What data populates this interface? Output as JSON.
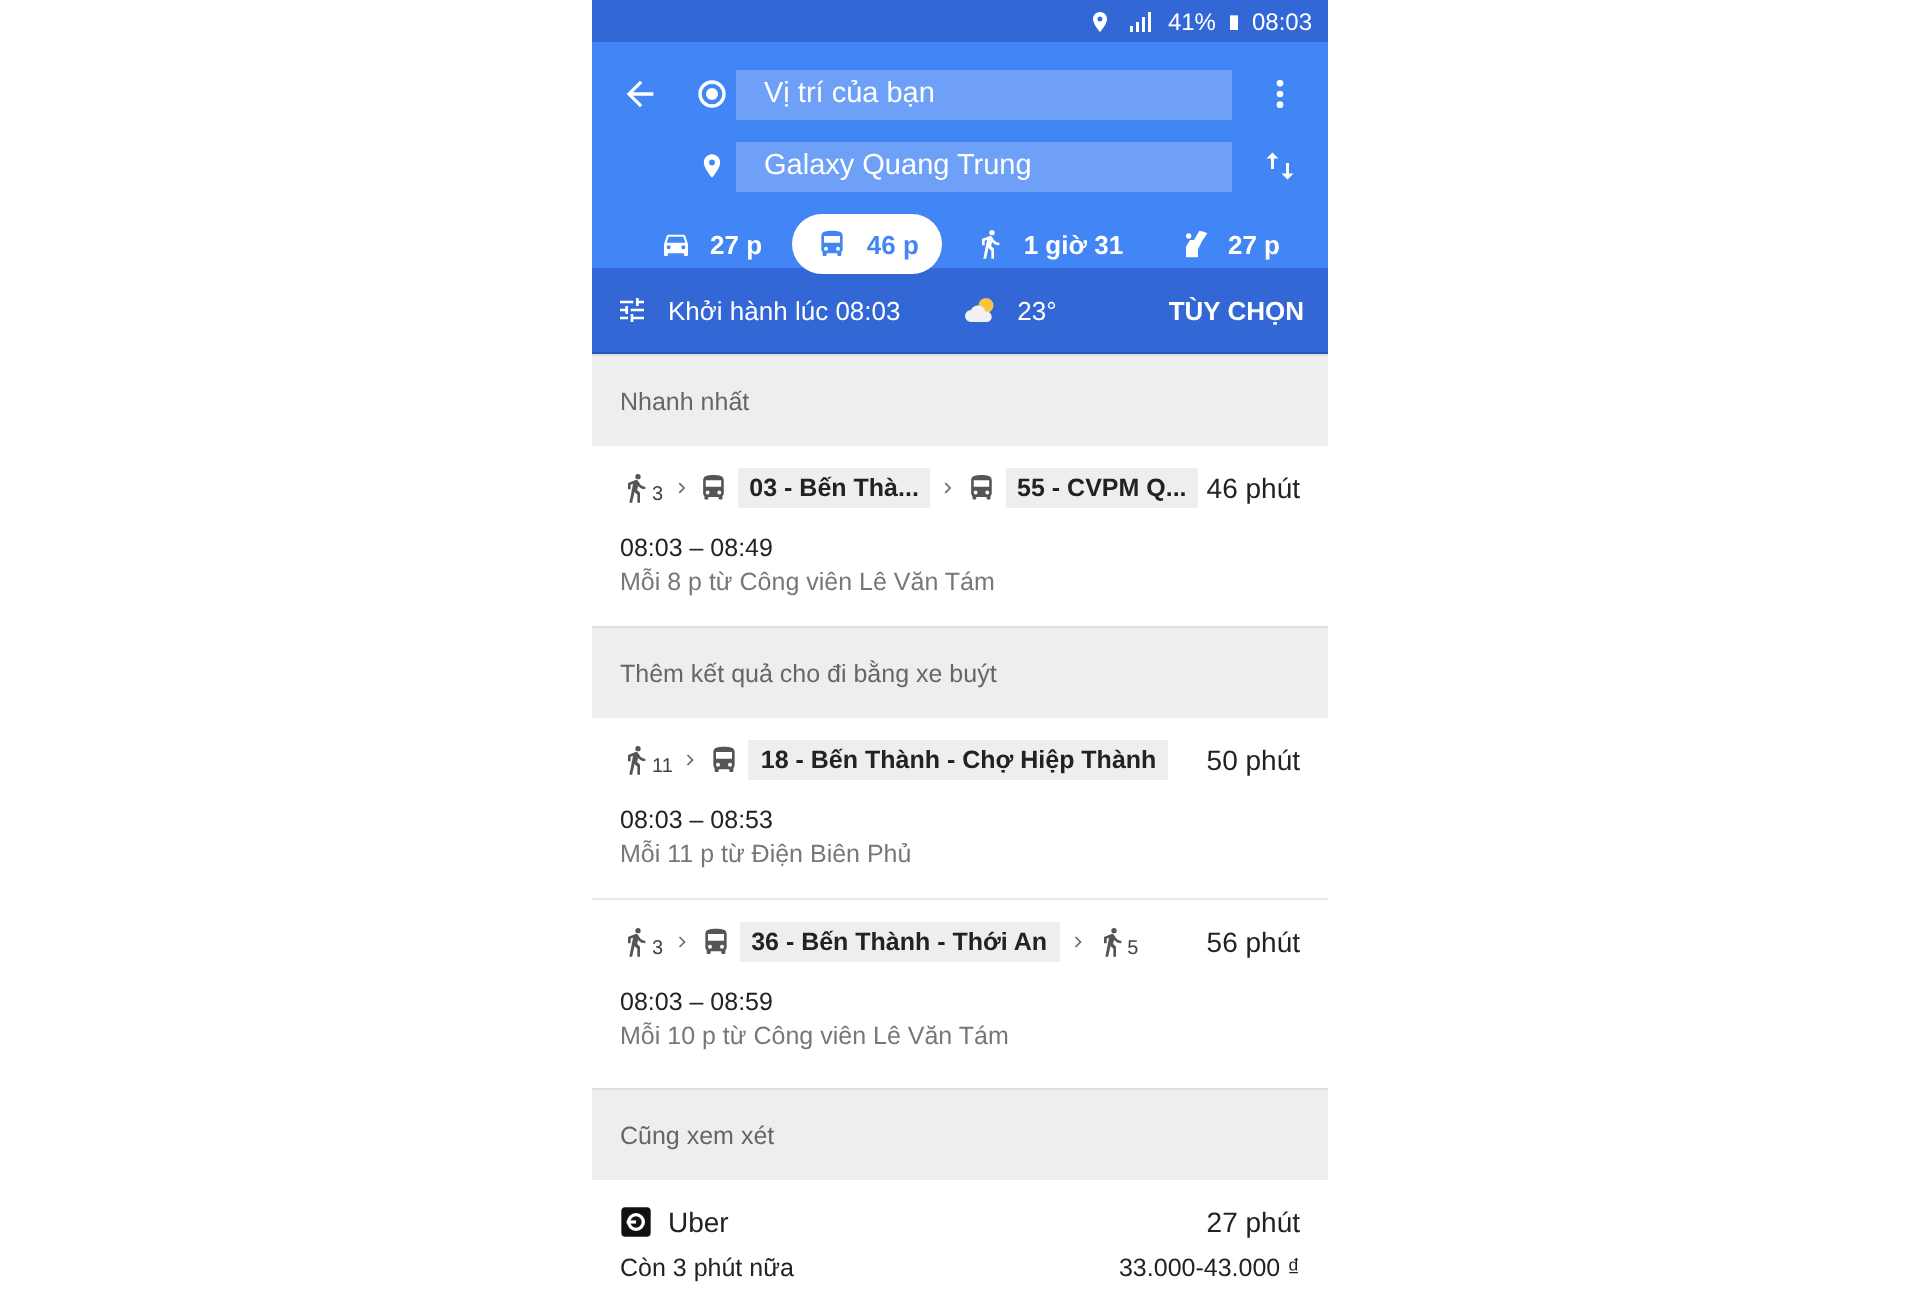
{
  "status_bar": {
    "battery": "41%",
    "time": "08:03"
  },
  "directions": {
    "origin": "Vị trí của bạn",
    "destination": "Galaxy Quang Trung"
  },
  "modes": [
    {
      "kind": "car",
      "label": "27 p",
      "selected": false
    },
    {
      "kind": "transit",
      "label": "46 p",
      "selected": true
    },
    {
      "kind": "walk",
      "label": "1 giờ 31",
      "selected": false
    },
    {
      "kind": "ride",
      "label": "27 p",
      "selected": false
    }
  ],
  "options_bar": {
    "departure": "Khởi hành lúc 08:03",
    "temperature": "23°",
    "options_button": "TÙY CHỌN"
  },
  "sections": [
    {
      "title": "Nhanh nhất",
      "routes": [
        {
          "steps": [
            {
              "kind": "walk",
              "minutes": "3"
            },
            {
              "kind": "bus",
              "line": "03 - Bến Thà..."
            },
            {
              "kind": "bus",
              "line": "55 - CVPM Q..."
            }
          ],
          "duration": "46 phút",
          "times": "08:03 – 08:49",
          "frequency": "Mỗi 8 p từ Công viên Lê Văn Tám"
        }
      ]
    },
    {
      "title": "Thêm kết quả cho đi bằng xe buýt",
      "routes": [
        {
          "steps": [
            {
              "kind": "walk",
              "minutes": "11"
            },
            {
              "kind": "bus",
              "line": "18 - Bến Thành - Chợ Hiệp Thành"
            }
          ],
          "duration": "50 phút",
          "times": "08:03 – 08:53",
          "frequency": "Mỗi 11 p từ Điện Biên Phủ"
        },
        {
          "steps": [
            {
              "kind": "walk",
              "minutes": "3"
            },
            {
              "kind": "bus",
              "line": "36 - Bến Thành - Thới An"
            },
            {
              "kind": "walk",
              "minutes": "5"
            }
          ],
          "duration": "56 phút",
          "times": "08:03 – 08:59",
          "frequency": "Mỗi 10 p từ Công viên Lê Văn Tám"
        }
      ]
    },
    {
      "title": "Cũng xem xét",
      "ride": {
        "name": "Uber",
        "duration": "27 phút",
        "wait": "Còn 3 phút nữa",
        "price": "33.000-43.000 ₫"
      }
    }
  ]
}
